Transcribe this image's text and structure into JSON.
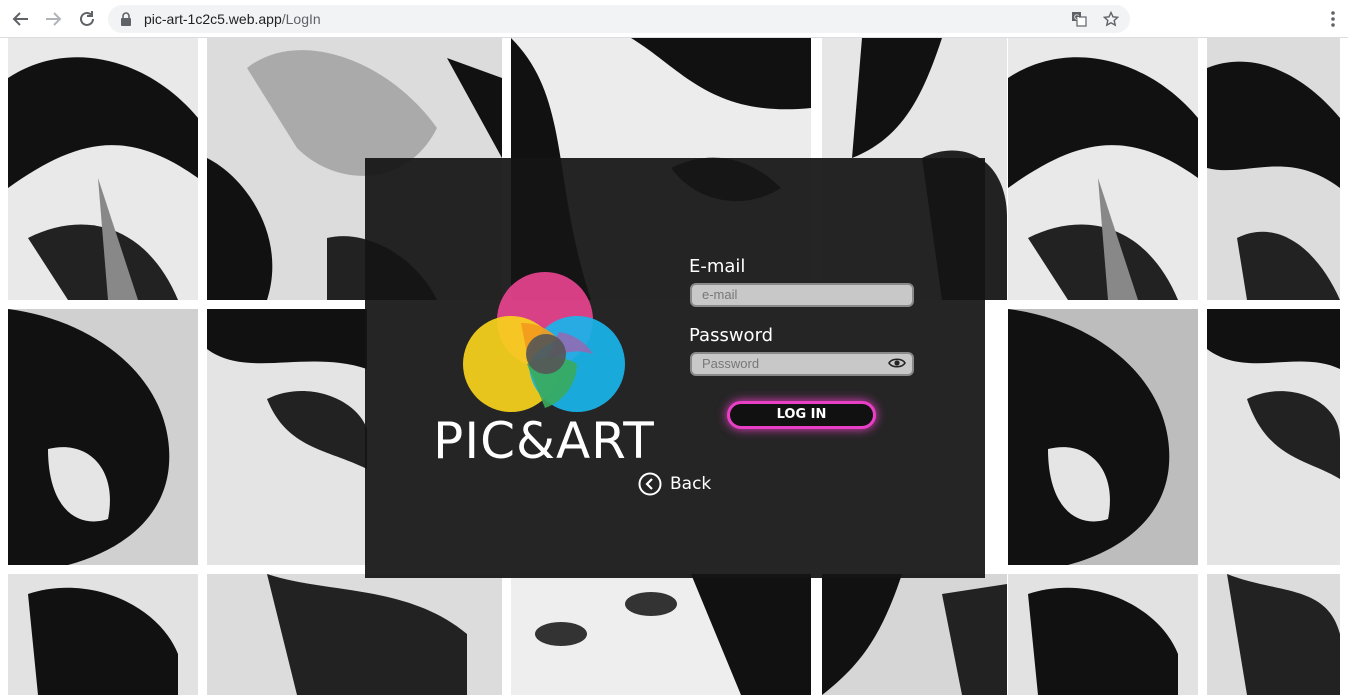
{
  "browser": {
    "url_host": "pic-art-1c2c5.web.app",
    "url_path": "/LogIn",
    "icons": [
      "back-arrow-icon",
      "forward-arrow-icon",
      "reload-icon",
      "lock-icon",
      "translate-icon",
      "star-icon",
      "more-vert-icon"
    ]
  },
  "brand": {
    "name": "PIC&ART",
    "colors": {
      "magenta": "#e8438f",
      "yellow": "#f9d21b",
      "cyan": "#19b4ea",
      "accent": "#e93fc6"
    }
  },
  "form": {
    "email_label": "E-mail",
    "email_placeholder": "e-mail",
    "password_label": "Password",
    "password_placeholder": "Password",
    "login_label": "LOG IN",
    "back_label": "Back"
  }
}
